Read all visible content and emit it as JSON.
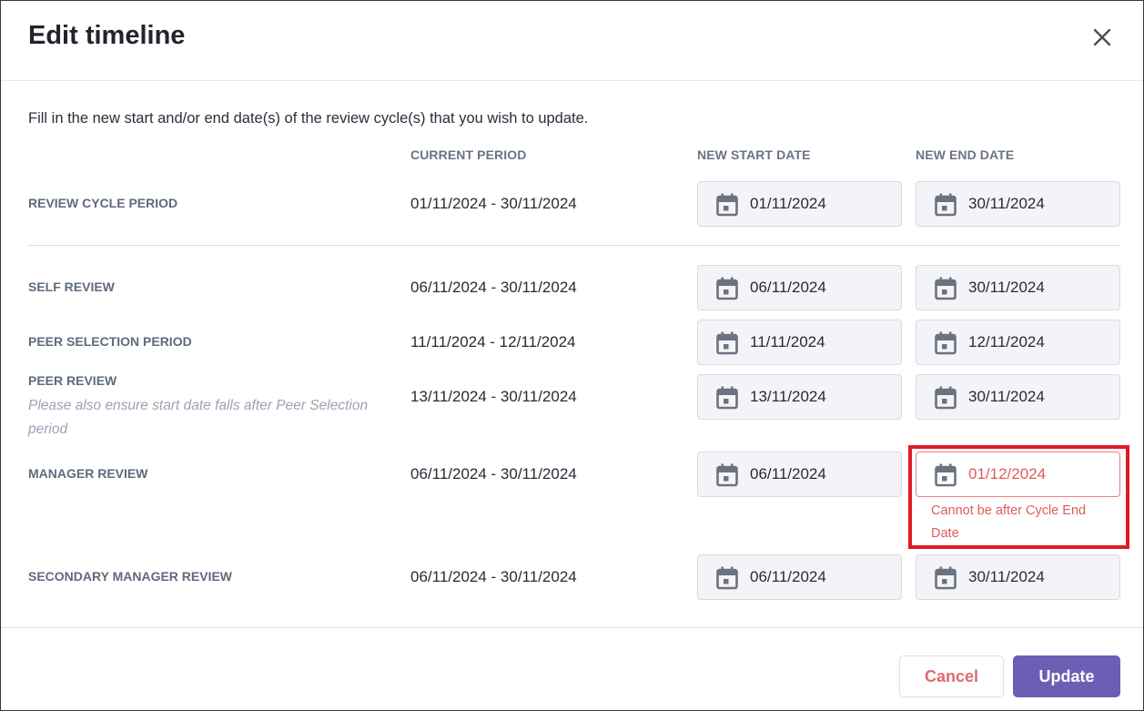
{
  "dialog": {
    "title": "Edit timeline",
    "instruction": "Fill in the new start and/or end date(s) of the review cycle(s) that you wish to update."
  },
  "columns": {
    "current_period": "CURRENT PERIOD",
    "new_start": "NEW START DATE",
    "new_end": "NEW END DATE"
  },
  "rows": [
    {
      "label": "REVIEW CYCLE PERIOD",
      "period": "01/11/2024 - 30/11/2024",
      "start": "01/11/2024",
      "end": "30/11/2024"
    },
    {
      "label": "SELF REVIEW",
      "period": "06/11/2024 - 30/11/2024",
      "start": "06/11/2024",
      "end": "30/11/2024"
    },
    {
      "label": "PEER SELECTION PERIOD",
      "period": "11/11/2024 - 12/11/2024",
      "start": "11/11/2024",
      "end": "12/11/2024"
    },
    {
      "label": "PEER REVIEW",
      "note": "Please also ensure start date falls after Peer Selection period",
      "period": "13/11/2024 - 30/11/2024",
      "start": "13/11/2024",
      "end": "30/11/2024"
    },
    {
      "label": "MANAGER REVIEW",
      "period": "06/11/2024 - 30/11/2024",
      "start": "06/11/2024",
      "end": "01/12/2024",
      "end_error": "Cannot be after Cycle End Date"
    },
    {
      "label": "SECONDARY MANAGER REVIEW",
      "period": "06/11/2024 - 30/11/2024",
      "start": "06/11/2024",
      "end": "30/11/2024"
    }
  ],
  "buttons": {
    "cancel": "Cancel",
    "update": "Update"
  },
  "icons": {
    "close": "close-icon",
    "date": "calendar-icon"
  },
  "colors": {
    "accent": "#6b5fb5",
    "error": "#e05b5b",
    "highlight": "#e01b24"
  }
}
